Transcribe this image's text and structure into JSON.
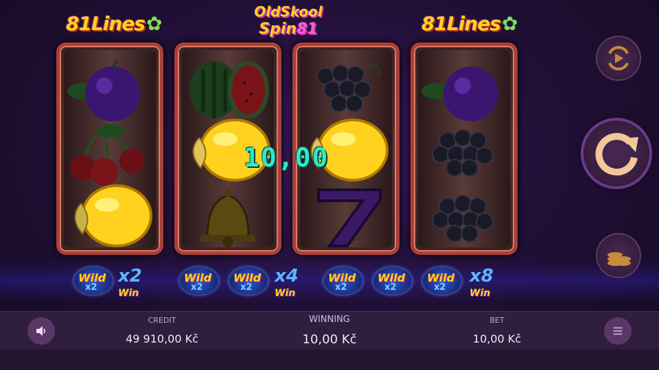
{
  "game": {
    "title_line1": "OldSkool",
    "title_line2": "Spin",
    "title_number": "81",
    "badge_left": "81Lines",
    "badge_right": "81Lines"
  },
  "reels": [
    {
      "symbols": [
        "plum-icon",
        "cherries-icon",
        "lemon-icon"
      ]
    },
    {
      "symbols": [
        "watermelon-icon",
        "lemon-icon",
        "bell-icon"
      ]
    },
    {
      "symbols": [
        "grapes-icon",
        "lemon-icon",
        "seven-icon"
      ]
    },
    {
      "symbols": [
        "plum-icon",
        "grapes-icon",
        "grapes-icon"
      ]
    }
  ],
  "win_display": "10,00",
  "multipliers": {
    "wild_label": "Wild",
    "wild_sub": "x2",
    "m1": "x2",
    "m2": "x4",
    "m3": "x8",
    "win_word": "Win"
  },
  "bottom_bar": {
    "credit_label": "CREDIT",
    "credit_value": "49 910,00 Kč",
    "winning_label": "WINNING",
    "winning_value": "10,00 Kč",
    "bet_label": "BET",
    "bet_value": "10,00 Kč"
  },
  "colors": {
    "accent": "#2ee8c9",
    "reel_border": "#a8403a",
    "gold": "#ffd21f"
  }
}
